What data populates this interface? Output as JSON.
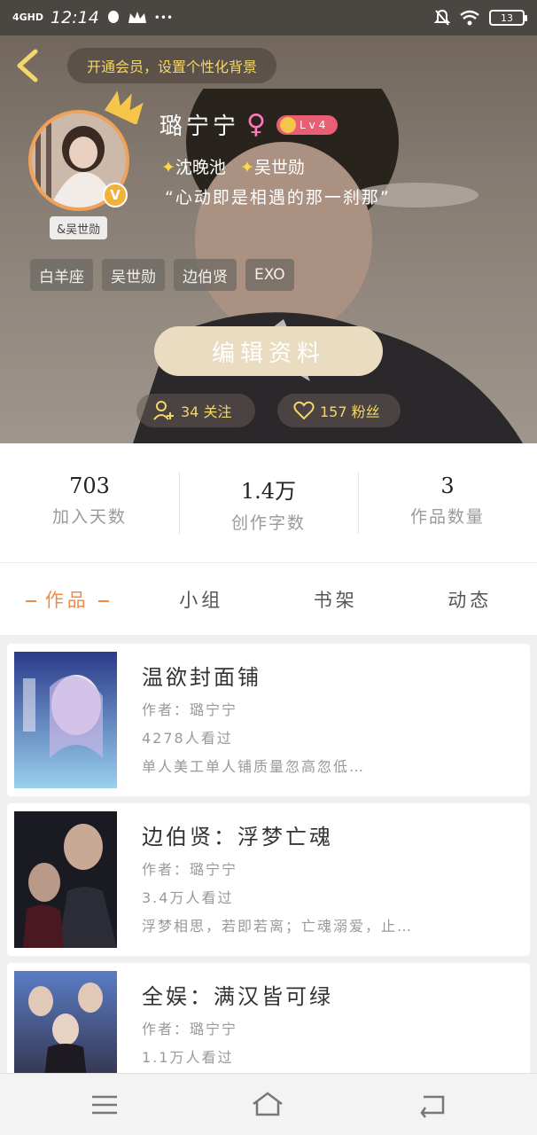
{
  "status_bar": {
    "network": "4GHD",
    "time": "12:14",
    "battery": "13",
    "icons": [
      "signal-icon",
      "qq-icon",
      "crown-icon",
      "more-dots-icon",
      "mute-icon",
      "wifi-icon",
      "battery-icon"
    ],
    "more": "•••"
  },
  "header": {
    "back_icon": "chevron-left-icon",
    "vip_banner": "开通会员，设置个性化背景"
  },
  "profile": {
    "username": "璐宁宁",
    "gender_symbol": "♀",
    "level": "Lv4",
    "avatar_tag": "&吴世勋",
    "verified": "V",
    "follows": [
      "沈晚池",
      "吴世勋"
    ],
    "signature": "“心动即是相遇的那一刹那”",
    "tags": [
      "白羊座",
      "吴世勋",
      "边伯贤",
      "EXO"
    ],
    "edit_label": "编辑资料",
    "following_label": "34 关注",
    "fans_label": "157 粉丝"
  },
  "stats": [
    {
      "value": "703",
      "label": "加入天数"
    },
    {
      "value": "1.4万",
      "label": "创作字数"
    },
    {
      "value": "3",
      "label": "作品数量"
    }
  ],
  "tabs": [
    "作品",
    "小组",
    "书架",
    "动态"
  ],
  "works": [
    {
      "title": "温欲封面铺",
      "author": "作者：璐宁宁",
      "views": "4278人看过",
      "desc": "单人美工单人铺质量忽高忽低…"
    },
    {
      "title": "边伯贤：浮梦亡魂",
      "author": "作者：璐宁宁",
      "views": "3.4万人看过",
      "desc": "浮梦相思，若即若离；亡魂溺爱，止…"
    },
    {
      "title": "全娱：满汉皆可绿",
      "author": "作者：璐宁宁",
      "views": "1.1万人看过",
      "desc": ""
    }
  ],
  "colors": {
    "accent": "#f08a45",
    "gold": "#f3d76a",
    "status_bar": "#4a4642"
  },
  "nav": [
    "menu-icon",
    "home-icon",
    "back-icon"
  ]
}
